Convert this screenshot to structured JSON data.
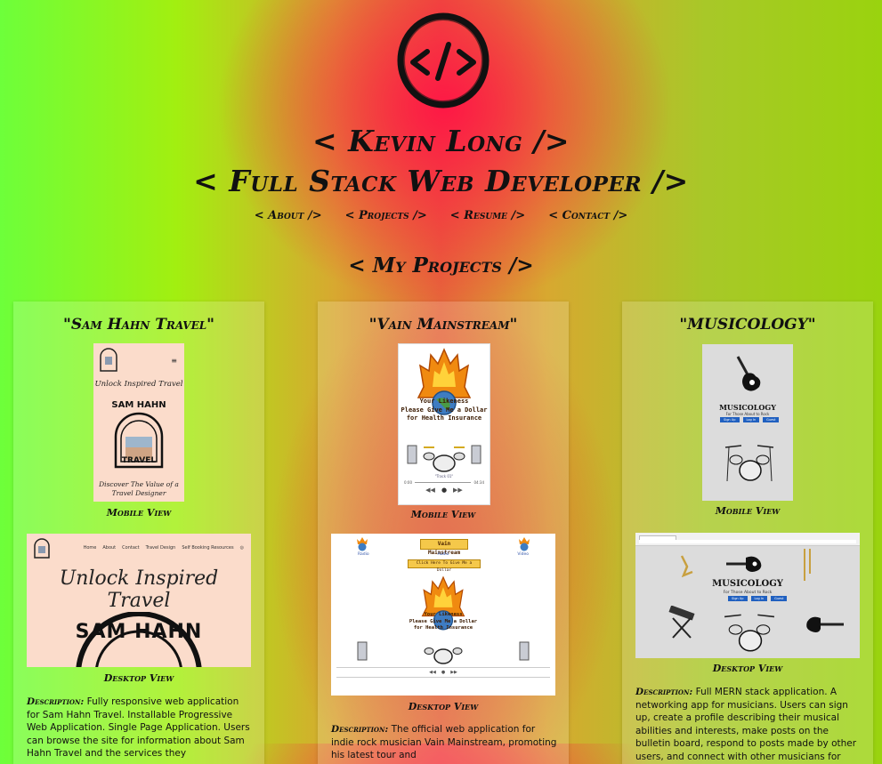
{
  "header": {
    "name": "< Kevin Long />",
    "role": "< Full Stack Web Developer />"
  },
  "nav": [
    {
      "label": "< About />"
    },
    {
      "label": "< Projects />"
    },
    {
      "label": "< Resume />"
    },
    {
      "label": "< Contact />"
    }
  ],
  "section_title": "< My Projects />",
  "projects": [
    {
      "title": "\"Sam Hahn Travel\"",
      "mobile_label": "Mobile View",
      "desktop_label": "Desktop View",
      "mobile_shot": {
        "tagline": "Unlock Inspired Travel",
        "badge_top": "SAM HAHN",
        "badge_bottom": "TRAVEL",
        "footer": "Discover The Value of a Travel Designer"
      },
      "desktop_shot": {
        "nav": [
          "Home",
          "About",
          "Contact",
          "Travel Design",
          "Self Booking Resources"
        ],
        "tagline": "Unlock Inspired Travel",
        "badge": "SAM HAHN"
      },
      "description_label": "Description:",
      "description": " Fully responsive web application for Sam Hahn Travel. Installable Progressive Web Application. Single Page Application. Users can browse the site for information about Sam Hahn Travel and the services they"
    },
    {
      "title": "\"Vain Mainstream\"",
      "mobile_label": "Mobile View",
      "desktop_label": "Desktop View",
      "mobile_shot": {
        "line1": "Your Likeness",
        "line2": "Please Give Me a Dollar",
        "line3": "for Health Insurance",
        "track": "\"Track 01\"",
        "time_start": "0:00",
        "time_end": "04:34"
      },
      "desktop_shot": {
        "title": "Vain Mainstream",
        "nav": [
          "Radio",
          "Audio",
          "Video"
        ],
        "donate": "Click Here To Give Me a Dollar",
        "line1": "Your Likeness",
        "line2": "Please Give Me a Dollar",
        "line3": "for Health Insurance"
      },
      "description_label": "Description:",
      "description": " The official web application for indie rock musician Vain Mainstream, promoting his latest tour and"
    },
    {
      "title": "\"MUSICOLOGY\"",
      "mobile_label": "Mobile View",
      "desktop_label": "Desktop View",
      "mobile_shot": {
        "brand": "MUSICOLOGY",
        "tagline": "For Those About to Rock",
        "buttons": [
          "Sign Up",
          "Log In",
          "Guest"
        ]
      },
      "desktop_shot": {
        "brand": "MUSICOLOGY",
        "tagline": "For Those About to Rock",
        "buttons": [
          "Sign Up",
          "Log In",
          "Guest"
        ]
      },
      "description_label": "Description:",
      "description": " Full MERN stack application. A networking app for musicians. Users can sign up, create a profile describing their musical abilities and interests, make posts on the bulletin board, respond to posts made by other users, and connect with other musicians for"
    }
  ],
  "colors": {
    "text": "#111111",
    "sam_bg": "#fbdccb",
    "vain_bg": "#ffffff",
    "music_bg": "#dcdcdc",
    "flame": "#f08a10"
  }
}
